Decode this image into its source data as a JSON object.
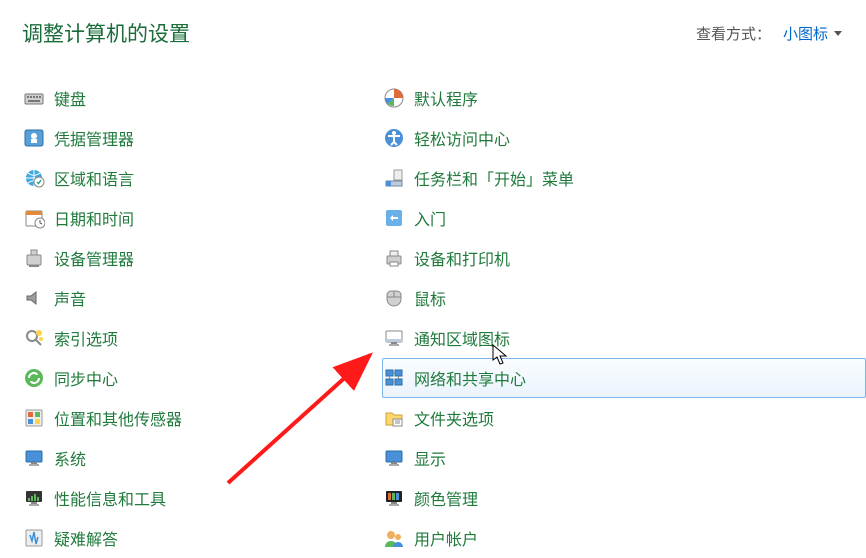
{
  "header": {
    "title": "调整计算机的设置",
    "view_label": "查看方式：",
    "view_value": "小图标"
  },
  "columns": {
    "left": [
      {
        "icon": "keyboard-icon",
        "label": "键盘"
      },
      {
        "icon": "credential-icon",
        "label": "凭据管理器"
      },
      {
        "icon": "region-lang-icon",
        "label": "区域和语言"
      },
      {
        "icon": "datetime-icon",
        "label": "日期和时间"
      },
      {
        "icon": "device-mgr-icon",
        "label": "设备管理器"
      },
      {
        "icon": "sound-icon",
        "label": "声音"
      },
      {
        "icon": "indexing-icon",
        "label": "索引选项"
      },
      {
        "icon": "sync-center-icon",
        "label": "同步中心"
      },
      {
        "icon": "sensors-icon",
        "label": "位置和其他传感器"
      },
      {
        "icon": "system-icon",
        "label": "系统"
      },
      {
        "icon": "perf-info-icon",
        "label": "性能信息和工具"
      },
      {
        "icon": "troubleshoot-icon",
        "label": "疑难解答"
      }
    ],
    "right": [
      {
        "icon": "default-programs-icon",
        "label": "默认程序"
      },
      {
        "icon": "ease-access-icon",
        "label": "轻松访问中心"
      },
      {
        "icon": "taskbar-start-icon",
        "label": "任务栏和「开始」菜单"
      },
      {
        "icon": "getting-started-icon",
        "label": "入门"
      },
      {
        "icon": "devices-printers-icon",
        "label": "设备和打印机"
      },
      {
        "icon": "mouse-icon",
        "label": "鼠标"
      },
      {
        "icon": "notify-icons-icon",
        "label": "通知区域图标"
      },
      {
        "icon": "network-sharing-icon",
        "label": "网络和共享中心",
        "hover": true
      },
      {
        "icon": "folder-options-icon",
        "label": "文件夹选项"
      },
      {
        "icon": "display-icon",
        "label": "显示"
      },
      {
        "icon": "color-mgmt-icon",
        "label": "颜色管理"
      },
      {
        "icon": "user-accounts-icon",
        "label": "用户帐户"
      }
    ]
  }
}
